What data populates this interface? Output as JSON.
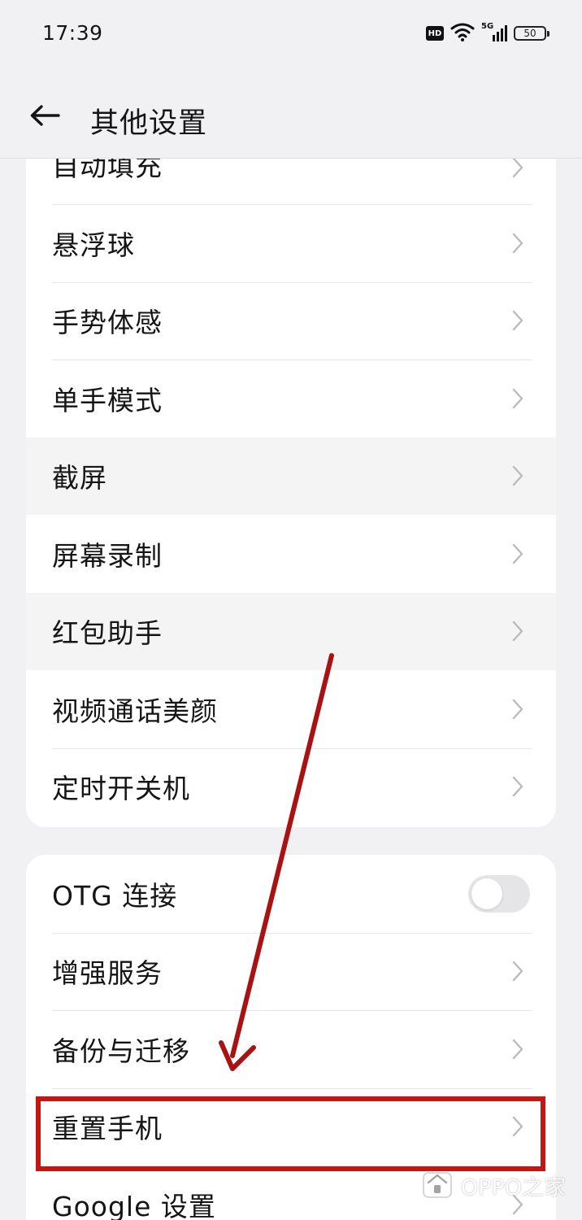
{
  "status_bar": {
    "time": "17:39",
    "badge": "HD",
    "network": "5G",
    "battery": "50"
  },
  "header": {
    "title": "其他设置",
    "back_icon": "back-arrow-icon"
  },
  "settings": {
    "group_1": [
      {
        "label": "自动填充",
        "chevron_icon": "chevron-right-icon"
      },
      {
        "label": "悬浮球",
        "chevron_icon": "chevron-right-icon"
      },
      {
        "label": "手势体感",
        "chevron_icon": "chevron-right-icon"
      },
      {
        "label": "单手模式",
        "chevron_icon": "chevron-right-icon"
      },
      {
        "label": "截屏",
        "chevron_icon": "chevron-right-icon"
      },
      {
        "label": "屏幕录制",
        "chevron_icon": "chevron-right-icon"
      },
      {
        "label": "红包助手",
        "chevron_icon": "chevron-right-icon"
      },
      {
        "label": "视频通话美颜",
        "chevron_icon": "chevron-right-icon"
      },
      {
        "label": "定时开关机",
        "chevron_icon": "chevron-right-icon"
      }
    ],
    "group_2": [
      {
        "label": "OTG 连接",
        "toggle": "off"
      },
      {
        "label": "增强服务",
        "chevron_icon": "chevron-right-icon"
      },
      {
        "label": "备份与迁移",
        "chevron_icon": "chevron-right-icon"
      },
      {
        "label": "重置手机",
        "chevron_icon": "chevron-right-icon"
      },
      {
        "label": "Google 设置",
        "chevron_icon": "chevron-right-icon"
      }
    ]
  },
  "annotation": {
    "color": "#c21712"
  },
  "watermark": {
    "text": "OPPO之家"
  }
}
